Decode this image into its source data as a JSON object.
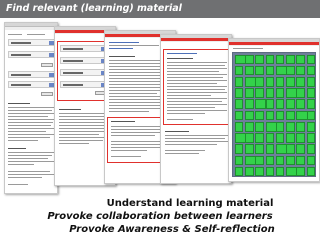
{
  "title": "Find relevant (learning) material",
  "captions": {
    "line1": "Understand learning material",
    "line2": "Provoke collaboration between learners",
    "line3": "Provoke Awareness & Self-reflection"
  },
  "colors": {
    "title_bar": "#6f7072",
    "highlight": "#e0312d",
    "tile_fill": "#33d24a",
    "grid_bg": "#6e7f9a"
  }
}
